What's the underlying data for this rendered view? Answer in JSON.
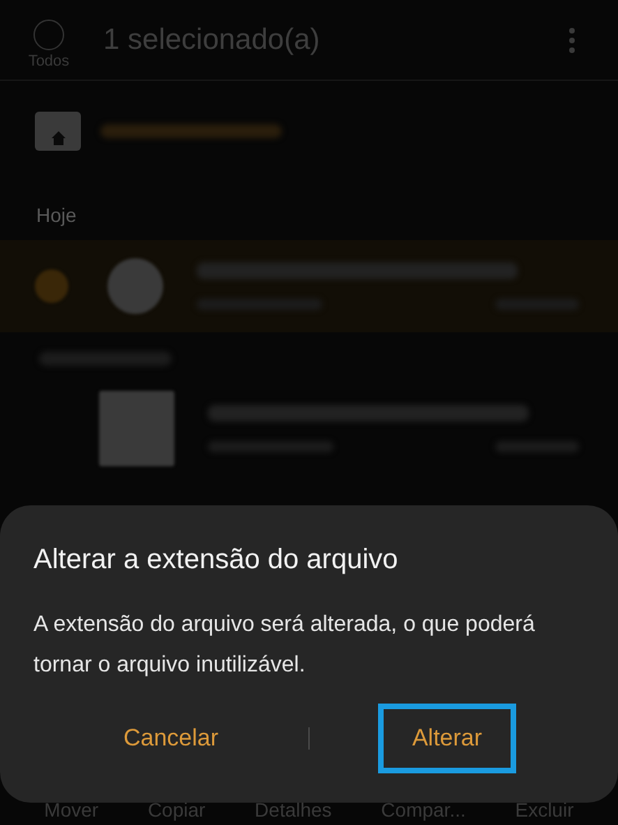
{
  "header": {
    "select_all_label": "Todos",
    "select_all_checked": false,
    "title": "1 selecionado(a)"
  },
  "sections": [
    {
      "title": "Hoje",
      "items": [
        {
          "selected": true,
          "kind": "round"
        }
      ]
    },
    {
      "items": [
        {
          "selected": false,
          "kind": "square"
        }
      ]
    }
  ],
  "bottom_bar": [
    "Mover",
    "Copiar",
    "Detalhes",
    "Compar...",
    "Excluir"
  ],
  "dialog": {
    "title": "Alterar a extensão do arquivo",
    "message": "A extensão do arquivo será alterada, o que poderá tornar o arquivo inutilizável.",
    "buttons": [
      {
        "label": "Cancelar",
        "highlighted": false
      },
      {
        "label": "Alterar",
        "highlighted": true
      }
    ]
  }
}
